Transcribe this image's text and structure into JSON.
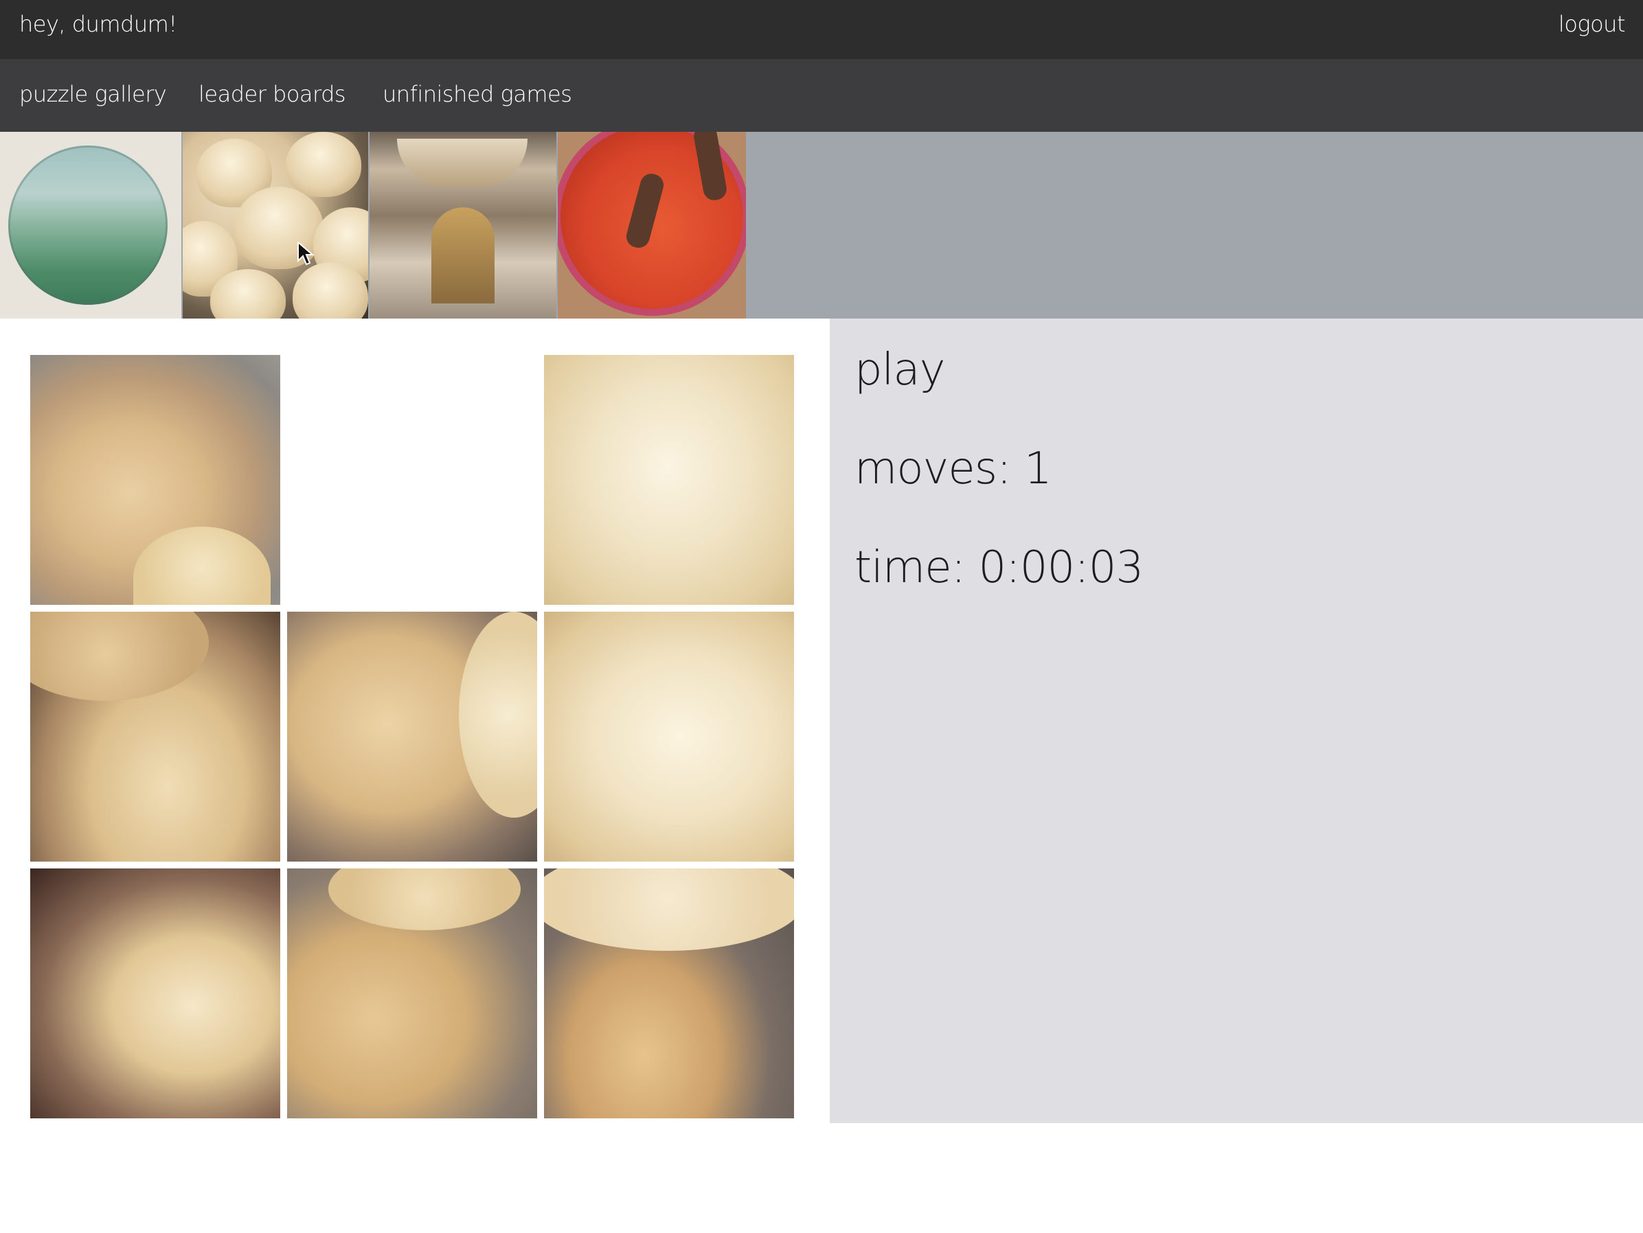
{
  "header": {
    "greeting": "hey, dumdum!",
    "logout_label": "logout"
  },
  "nav": {
    "items": [
      {
        "label": "puzzle gallery"
      },
      {
        "label": "leader boards"
      },
      {
        "label": "unfinished games"
      }
    ]
  },
  "gallery": {
    "thumbnails": [
      {
        "name": "landscape-circle-painting"
      },
      {
        "name": "soup-dumplings"
      },
      {
        "name": "museum-hall"
      },
      {
        "name": "red-sand-bowl"
      }
    ],
    "selected_index": 1
  },
  "puzzle": {
    "grid_size": 3,
    "empty_tile_index": 1,
    "tiles": [
      {
        "index": 0,
        "empty": false
      },
      {
        "index": 1,
        "empty": true
      },
      {
        "index": 2,
        "empty": false
      },
      {
        "index": 3,
        "empty": false
      },
      {
        "index": 4,
        "empty": false
      },
      {
        "index": 5,
        "empty": false
      },
      {
        "index": 6,
        "empty": false
      },
      {
        "index": 7,
        "empty": false
      },
      {
        "index": 8,
        "empty": false
      }
    ]
  },
  "game": {
    "play_label": "play",
    "moves_text": "moves: 1",
    "time_text": "time: 0:00:03"
  },
  "colors": {
    "topbar": "#2d2d2e",
    "navbar": "#3d3d40",
    "gallery_bg": "#a1a6ad",
    "side_panel": "#dfdee2"
  }
}
